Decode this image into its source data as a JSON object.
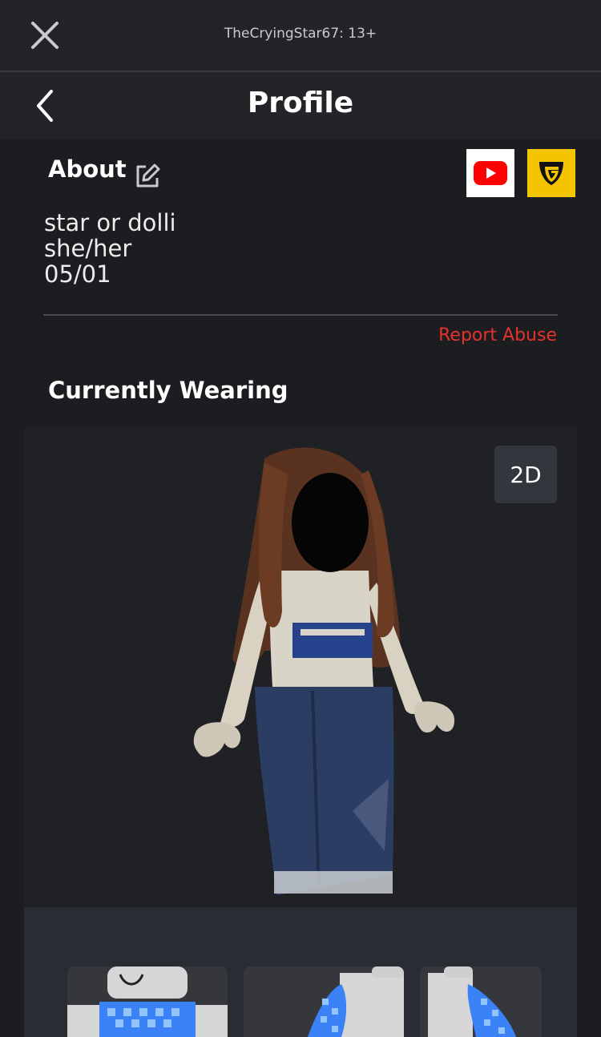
{
  "topbar": {
    "title": "TheCryingStar67: 13+",
    "close_icon": "close-icon"
  },
  "navbar": {
    "title": "Profile",
    "back_icon": "chevron-left-icon"
  },
  "about": {
    "header": "About",
    "edit_icon": "edit-icon",
    "bio_lines": [
      "star or dolli",
      "she/her",
      "05/01"
    ],
    "social_links": [
      {
        "icon": "youtube-icon",
        "color": "#ff0000"
      },
      {
        "icon": "guilded-icon",
        "color": "#f5c400"
      }
    ],
    "report_label": "Report Abuse"
  },
  "wearing": {
    "header": "Currently Wearing",
    "toggle_2d_label": "2D",
    "items": [
      {
        "icon": "avatar-item-thumbnail"
      },
      {
        "icon": "avatar-item-thumbnail"
      },
      {
        "icon": "avatar-item-thumbnail"
      }
    ]
  },
  "colors": {
    "background": "#1b1d21",
    "report": "#e5322d",
    "accent_guilded": "#f5c400"
  }
}
